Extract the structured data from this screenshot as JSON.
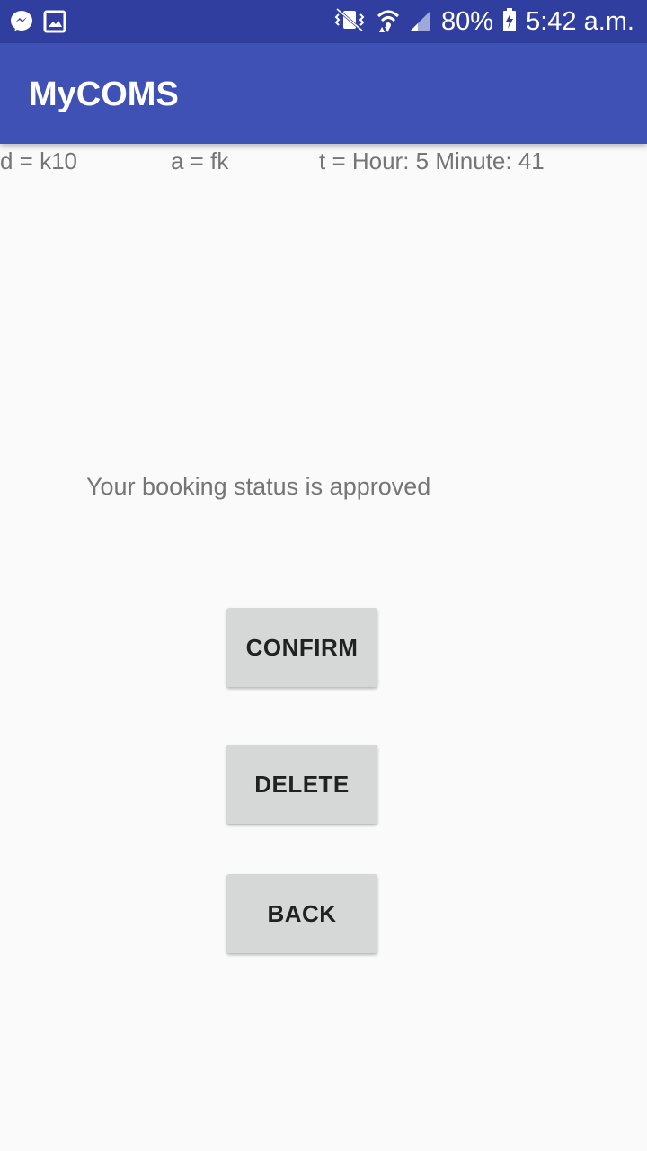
{
  "status_bar": {
    "left_icons": [
      "messenger-icon",
      "image-icon"
    ],
    "right_icons": [
      "vibrate-icon",
      "wifi-icon",
      "signal-icon",
      "battery-charging-icon"
    ],
    "battery": "80%",
    "time": "5:42 a.m."
  },
  "app_bar": {
    "title": "MyCOMS",
    "color": "#3f51b5"
  },
  "info": {
    "d": "d = k10",
    "a": "a = fk",
    "t": "t = Hour: 5 Minute: 41"
  },
  "message": "Your booking status is approved",
  "buttons": {
    "confirm": "CONFIRM",
    "delete": "DELETE",
    "back": "BACK"
  }
}
